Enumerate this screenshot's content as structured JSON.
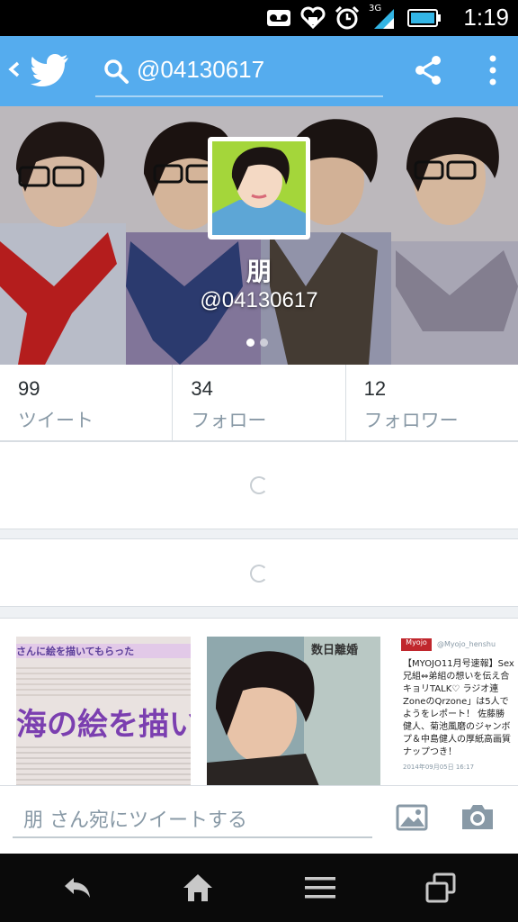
{
  "status_bar": {
    "time": "1:19",
    "network": "3G"
  },
  "app_bar": {
    "search_text": "@04130617",
    "colors": {
      "bar": "#55acee"
    }
  },
  "profile": {
    "name": "朋",
    "handle": "@04130617",
    "page_dots": 2,
    "active_dot": 1
  },
  "stats": [
    {
      "count": "99",
      "label": "ツイート"
    },
    {
      "count": "34",
      "label": "フォロー"
    },
    {
      "count": "12",
      "label": "フォロワー"
    }
  ],
  "media": {
    "thumb1": {
      "banner": "さんに絵を描いてもらった",
      "headline": "海の絵を描い"
    },
    "thumb2": {
      "title": "数日離婚"
    },
    "thumb3": {
      "brand": "Myojo",
      "account": "@Myojo_henshu",
      "lines": [
        "【MYOJO11月号速報】Sex",
        "兄組⇔弟組の想いを伝え合",
        "キョリTALK♡ ラジオ連",
        "ZoneのQrzone」は5人で",
        "ようをレポート！ 佐藤勝",
        "健人、菊池風磨のジャンボ",
        "プ＆中島健人の厚紙高画質",
        "ナップつき！"
      ],
      "date": "2014年09月05日 16:17"
    }
  },
  "compose": {
    "placeholder": "朋 さん宛にツイートする"
  }
}
